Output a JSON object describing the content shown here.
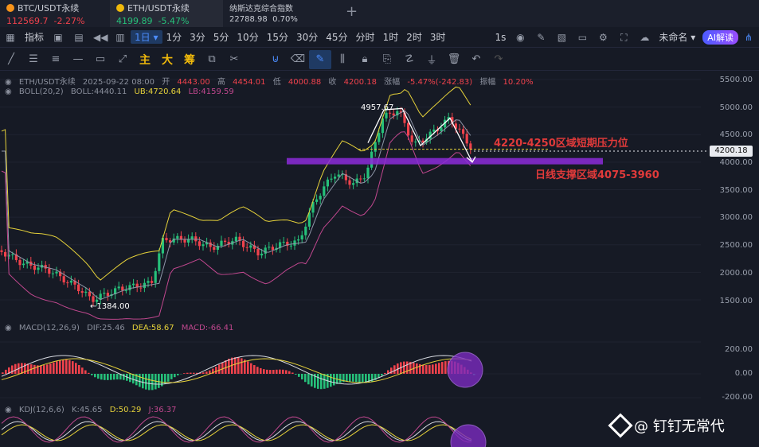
{
  "tabs": [
    {
      "name": "BTC/USDT永续",
      "price": "112569.7",
      "change": "-2.27%",
      "coin_color": "#f7931a"
    },
    {
      "name": "ETH/USDT永续",
      "price": "4199.89",
      "change": "-5.47%",
      "coin_color": "#f0b90b"
    },
    {
      "name": "纳斯达克综合指数",
      "price": "22788.98",
      "change": "0.70%"
    }
  ],
  "toolbar": {
    "indicators": "指标",
    "interval_selected": "1日",
    "intervals": [
      "1分",
      "3分",
      "5分",
      "10分",
      "15分",
      "30分",
      "45分",
      "分时",
      "1时",
      "2时",
      "3时"
    ],
    "seconds": "1s",
    "layout_name": "未命名",
    "ai_button": "AI解读"
  },
  "drawbar": {
    "chinese_tools": [
      "主",
      "大",
      "筹"
    ]
  },
  "legend": {
    "symbol": "ETH/USDT永续",
    "datetime": "2025-09-22 08:00",
    "open_label": "开",
    "open": "4443.00",
    "high_label": "高",
    "high": "4454.01",
    "low_label": "低",
    "low": "4000.88",
    "close_label": "收",
    "close": "4200.18",
    "change_label": "涨幅",
    "change": "-5.47%(-242.83)",
    "amp_label": "振幅",
    "amp": "10.20%"
  },
  "boll": {
    "label": "BOLL(20,2)",
    "mid": "BOLL:4440.11",
    "ub": "UB:4720.64",
    "lb": "LB:4159.59"
  },
  "macd": {
    "label": "MACD(12,26,9)",
    "dif": "DIF:25.46",
    "dea": "DEA:58.67",
    "macd": "MACD:-66.41"
  },
  "kdj": {
    "label": "KDJ(12,6,6)",
    "k": "K:45.65",
    "d": "D:50.29",
    "j": "J:36.37"
  },
  "price_axis": [
    "5500.00",
    "5000.00",
    "4500.00",
    "4000.00",
    "3500.00",
    "3000.00",
    "2500.00",
    "2000.00",
    "1500.00"
  ],
  "macd_axis": [
    "200.00",
    "0.00",
    "-200.00"
  ],
  "current_price": "4200.18",
  "annotations": {
    "high_label": "4957.67",
    "low_label": "←1384.00",
    "resistance": "4220-4250区域短期压力位",
    "support": "日线支撑区域4075-3960"
  },
  "watermark": "@ 钉钉无常代",
  "colors": {
    "up": "#26c07a",
    "down": "#f0424c",
    "boll_mid": "#8e96a8",
    "boll_ub": "#e6d23a",
    "boll_lb": "#c0478e",
    "support_band": "#8c2bd9",
    "accent": "#4c8dff"
  }
}
